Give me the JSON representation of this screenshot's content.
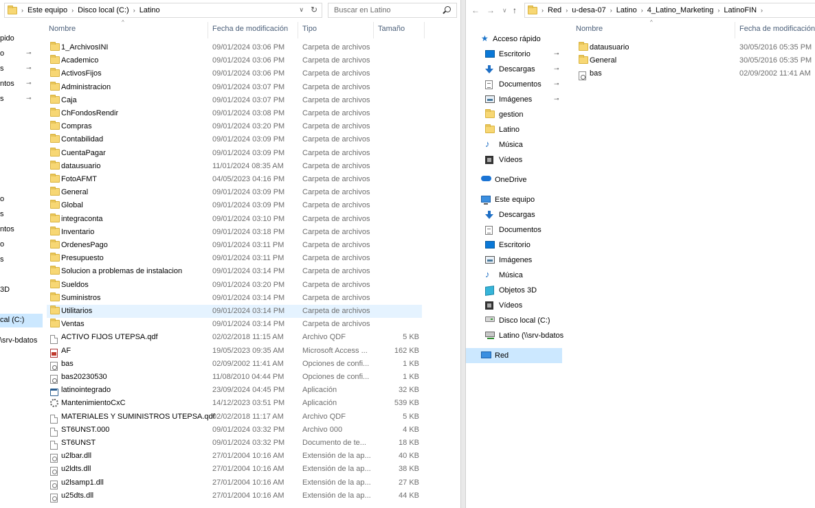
{
  "left_window": {
    "breadcrumb": [
      "Este equipo",
      "Disco local (C:)",
      "Latino"
    ],
    "search_placeholder": "Buscar en Latino",
    "nav_stub": [
      "pido",
      "o",
      "s",
      "ntos",
      "s",
      "o",
      "s",
      "ntos",
      "o",
      "s",
      "3D",
      "cal (C:)",
      "\\srv-bdatos"
    ],
    "columns": {
      "name": "Nombre",
      "date": "Fecha de modificación",
      "type": "Tipo",
      "size": "Tamaño"
    },
    "files": [
      {
        "icon": "folder",
        "name": "1_ArchivosINI",
        "date": "09/01/2024 03:06 PM",
        "type": "Carpeta de archivos",
        "size": ""
      },
      {
        "icon": "folder",
        "name": "Academico",
        "date": "09/01/2024 03:06 PM",
        "type": "Carpeta de archivos",
        "size": ""
      },
      {
        "icon": "folder",
        "name": "ActivosFijos",
        "date": "09/01/2024 03:06 PM",
        "type": "Carpeta de archivos",
        "size": ""
      },
      {
        "icon": "folder",
        "name": "Administracion",
        "date": "09/01/2024 03:07 PM",
        "type": "Carpeta de archivos",
        "size": ""
      },
      {
        "icon": "folder",
        "name": "Caja",
        "date": "09/01/2024 03:07 PM",
        "type": "Carpeta de archivos",
        "size": ""
      },
      {
        "icon": "folder",
        "name": "ChFondosRendir",
        "date": "09/01/2024 03:08 PM",
        "type": "Carpeta de archivos",
        "size": ""
      },
      {
        "icon": "folder",
        "name": "Compras",
        "date": "09/01/2024 03:20 PM",
        "type": "Carpeta de archivos",
        "size": ""
      },
      {
        "icon": "folder",
        "name": "Contabilidad",
        "date": "09/01/2024 03:09 PM",
        "type": "Carpeta de archivos",
        "size": ""
      },
      {
        "icon": "folder",
        "name": "CuentaPagar",
        "date": "09/01/2024 03:09 PM",
        "type": "Carpeta de archivos",
        "size": ""
      },
      {
        "icon": "folder",
        "name": "datausuario",
        "date": "11/01/2024 08:35 AM",
        "type": "Carpeta de archivos",
        "size": ""
      },
      {
        "icon": "folder",
        "name": "FotoAFMT",
        "date": "04/05/2023 04:16 PM",
        "type": "Carpeta de archivos",
        "size": ""
      },
      {
        "icon": "folder",
        "name": "General",
        "date": "09/01/2024 03:09 PM",
        "type": "Carpeta de archivos",
        "size": ""
      },
      {
        "icon": "folder",
        "name": "Global",
        "date": "09/01/2024 03:09 PM",
        "type": "Carpeta de archivos",
        "size": ""
      },
      {
        "icon": "folder",
        "name": "integraconta",
        "date": "09/01/2024 03:10 PM",
        "type": "Carpeta de archivos",
        "size": ""
      },
      {
        "icon": "folder",
        "name": "Inventario",
        "date": "09/01/2024 03:18 PM",
        "type": "Carpeta de archivos",
        "size": ""
      },
      {
        "icon": "folder",
        "name": "OrdenesPago",
        "date": "09/01/2024 03:11 PM",
        "type": "Carpeta de archivos",
        "size": ""
      },
      {
        "icon": "folder",
        "name": "Presupuesto",
        "date": "09/01/2024 03:11 PM",
        "type": "Carpeta de archivos",
        "size": ""
      },
      {
        "icon": "folder",
        "name": "Solucion a problemas de instalacion",
        "date": "09/01/2024 03:14 PM",
        "type": "Carpeta de archivos",
        "size": ""
      },
      {
        "icon": "folder",
        "name": "Sueldos",
        "date": "09/01/2024 03:20 PM",
        "type": "Carpeta de archivos",
        "size": ""
      },
      {
        "icon": "folder",
        "name": "Suministros",
        "date": "09/01/2024 03:14 PM",
        "type": "Carpeta de archivos",
        "size": ""
      },
      {
        "icon": "folder",
        "name": "Utilitarios",
        "date": "09/01/2024 03:14 PM",
        "type": "Carpeta de archivos",
        "size": "",
        "selected": true
      },
      {
        "icon": "folder",
        "name": "Ventas",
        "date": "09/01/2024 03:14 PM",
        "type": "Carpeta de archivos",
        "size": ""
      },
      {
        "icon": "file",
        "name": "ACTIVO FIJOS UTEPSA.qdf",
        "date": "02/02/2018 11:15 AM",
        "type": "Archivo QDF",
        "size": "5 KB"
      },
      {
        "icon": "pdf",
        "name": "AF",
        "date": "19/05/2023 09:35 AM",
        "type": "Microsoft Access ...",
        "size": "162 KB"
      },
      {
        "icon": "cfg",
        "name": "bas",
        "date": "02/09/2002 11:41 AM",
        "type": "Opciones de confi...",
        "size": "1 KB"
      },
      {
        "icon": "cfg",
        "name": "bas20230530",
        "date": "11/08/2010 04:44 PM",
        "type": "Opciones de confi...",
        "size": "1 KB"
      },
      {
        "icon": "app",
        "name": "latinointegrado",
        "date": "23/09/2024 04:45 PM",
        "type": "Aplicación",
        "size": "32 KB"
      },
      {
        "icon": "gear",
        "name": "MantenimientoCxC",
        "date": "14/12/2023 03:51 PM",
        "type": "Aplicación",
        "size": "539 KB"
      },
      {
        "icon": "file",
        "name": "MATERIALES Y SUMINISTROS UTEPSA.qdf",
        "date": "02/02/2018 11:17 AM",
        "type": "Archivo QDF",
        "size": "5 KB"
      },
      {
        "icon": "file",
        "name": "ST6UNST.000",
        "date": "09/01/2024 03:32 PM",
        "type": "Archivo 000",
        "size": "4 KB"
      },
      {
        "icon": "file",
        "name": "ST6UNST",
        "date": "09/01/2024 03:32 PM",
        "type": "Documento de te...",
        "size": "18 KB"
      },
      {
        "icon": "dll",
        "name": "u2lbar.dll",
        "date": "27/01/2004 10:16 AM",
        "type": "Extensión de la ap...",
        "size": "40 KB"
      },
      {
        "icon": "dll",
        "name": "u2ldts.dll",
        "date": "27/01/2004 10:16 AM",
        "type": "Extensión de la ap...",
        "size": "38 KB"
      },
      {
        "icon": "dll",
        "name": "u2lsamp1.dll",
        "date": "27/01/2004 10:16 AM",
        "type": "Extensión de la ap...",
        "size": "27 KB"
      },
      {
        "icon": "dll",
        "name": "u25dts.dll",
        "date": "27/01/2004 10:16 AM",
        "type": "Extensión de la ap...",
        "size": "44 KB"
      }
    ]
  },
  "right_window": {
    "breadcrumb": [
      "Red",
      "u-desa-07",
      "Latino",
      "4_Latino_Marketing",
      "LatinoFIN"
    ],
    "columns": {
      "name": "Nombre",
      "date": "Fecha de modificación"
    },
    "nav": [
      {
        "icon": "star",
        "label": "Acceso rápido",
        "pinned": false
      },
      {
        "icon": "desktop",
        "label": "Escritorio",
        "pinned": true
      },
      {
        "icon": "download",
        "label": "Descargas",
        "pinned": true
      },
      {
        "icon": "document",
        "label": "Documentos",
        "pinned": true
      },
      {
        "icon": "image",
        "label": "Imágenes",
        "pinned": true
      },
      {
        "icon": "folder",
        "label": "gestion",
        "pinned": false
      },
      {
        "icon": "folder",
        "label": "Latino",
        "pinned": false
      },
      {
        "icon": "music",
        "label": "Música",
        "pinned": false
      },
      {
        "icon": "video",
        "label": "Vídeos",
        "pinned": false
      },
      {
        "icon": "cloud",
        "label": "OneDrive",
        "pinned": false
      },
      {
        "icon": "pc",
        "label": "Este equipo",
        "pinned": false
      },
      {
        "icon": "download",
        "label": "Descargas",
        "pinned": false
      },
      {
        "icon": "document",
        "label": "Documentos",
        "pinned": false
      },
      {
        "icon": "desktop",
        "label": "Escritorio",
        "pinned": false
      },
      {
        "icon": "image",
        "label": "Imágenes",
        "pinned": false
      },
      {
        "icon": "music",
        "label": "Música",
        "pinned": false
      },
      {
        "icon": "cube",
        "label": "Objetos 3D",
        "pinned": false
      },
      {
        "icon": "video",
        "label": "Vídeos",
        "pinned": false
      },
      {
        "icon": "disk",
        "label": "Disco local (C:)",
        "pinned": false
      },
      {
        "icon": "netdrive",
        "label": "Latino (\\\\srv-bdatos",
        "pinned": false
      },
      {
        "icon": "network",
        "label": "Red",
        "pinned": false,
        "active": true
      }
    ],
    "files": [
      {
        "icon": "folder",
        "name": "datausuario",
        "date": "30/05/2016 05:35 PM"
      },
      {
        "icon": "folder",
        "name": "General",
        "date": "30/05/2016 05:35 PM"
      },
      {
        "icon": "cfg",
        "name": "bas",
        "date": "02/09/2002 11:41 AM"
      }
    ]
  },
  "colors": {
    "selected_row": "#e5f3ff",
    "nav_active": "#cce8ff",
    "header_text": "#4c607a",
    "folder": "#f7d774"
  }
}
